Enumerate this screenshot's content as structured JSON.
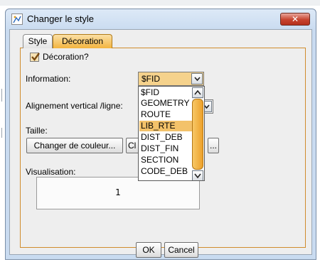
{
  "window": {
    "title": "Changer le style",
    "close_label": "✕"
  },
  "tabs": [
    {
      "label": "Style"
    },
    {
      "label": "Décoration"
    }
  ],
  "decoration": {
    "checkbox_label": "Décoration?",
    "checked": true,
    "information_label": "Information:",
    "information_value": "$FID",
    "alignment_label": "Alignement vertical /ligne:",
    "size_label": "Taille:",
    "change_color_button": "Changer de couleur...",
    "second_button": "Cl",
    "third_button": "...",
    "visualisation_label": "Visualisation:",
    "visualisation_value": "1"
  },
  "dropdown": {
    "options": [
      "$FID",
      "GEOMETRY",
      "ROUTE",
      "LIB_RTE",
      "DIST_DEB",
      "DIST_FIN",
      "SECTION",
      "CODE_DEB"
    ],
    "selected": "LIB_RTE"
  },
  "buttons": {
    "ok": "OK",
    "cancel": "Cancel"
  },
  "colors": {
    "accent": "#f3b43f",
    "selection": "#f3c26a",
    "close": "#c7432f"
  }
}
